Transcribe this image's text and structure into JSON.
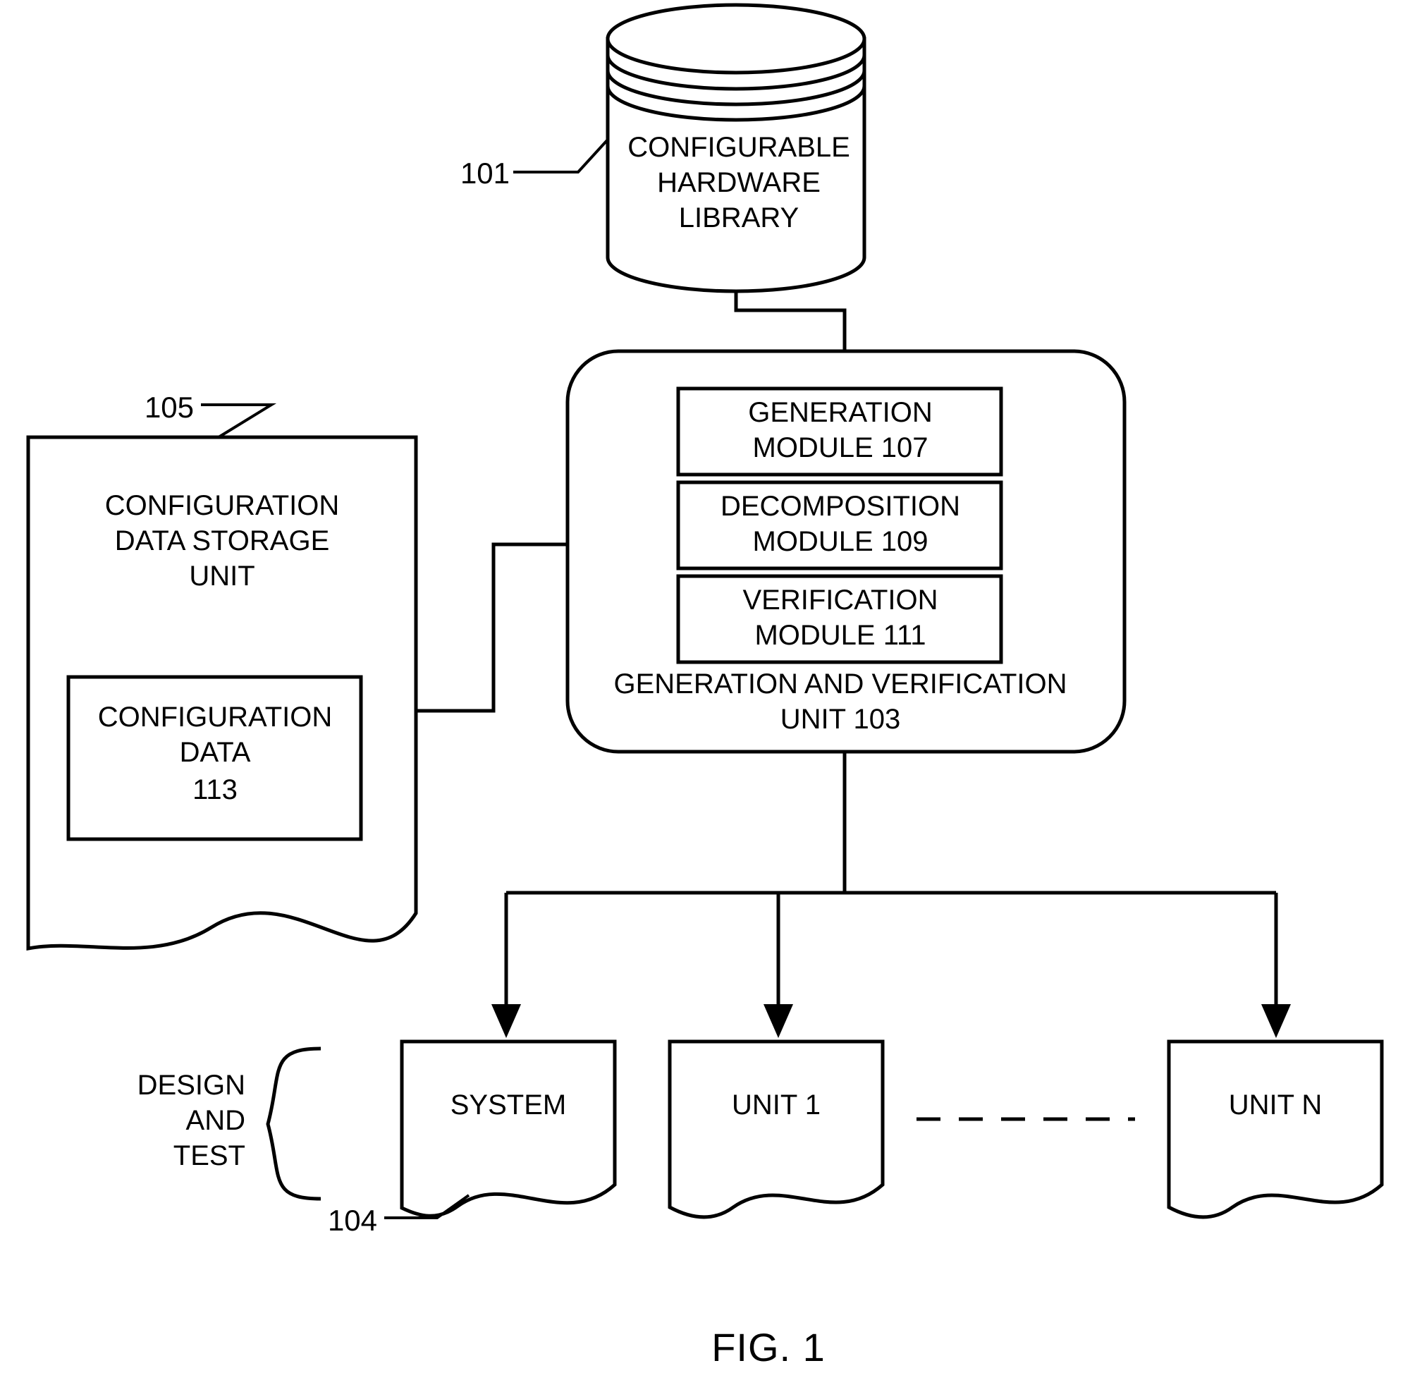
{
  "figure": {
    "caption": "FIG. 1",
    "background_color": "#ffffff",
    "line_color": "#000000"
  },
  "nodes": {
    "library": {
      "shape": "cylinder",
      "ref": "101",
      "lines": [
        "CONFIGURABLE",
        "HARDWARE",
        "LIBRARY"
      ]
    },
    "storage_unit": {
      "shape": "torn-document",
      "ref": "105",
      "lines": [
        "CONFIGURATION",
        "DATA STORAGE",
        "UNIT"
      ]
    },
    "configuration_data": {
      "shape": "rectangle",
      "lines": [
        "CONFIGURATION",
        "DATA",
        "113"
      ]
    },
    "gv_unit": {
      "shape": "rounded-rectangle",
      "ref": "103",
      "lines": [
        "GENERATION AND VERIFICATION",
        "UNIT  103"
      ]
    },
    "generation_module": {
      "shape": "rectangle",
      "ref": "107",
      "lines": [
        "GENERATION",
        "MODULE  107"
      ]
    },
    "decomposition_module": {
      "shape": "rectangle",
      "ref": "109",
      "lines": [
        "DECOMPOSITION",
        "MODULE    109"
      ]
    },
    "verification_module": {
      "shape": "rectangle",
      "ref": "111",
      "lines": [
        "VERIFICATION",
        "MODULE 111"
      ]
    },
    "system": {
      "shape": "torn-document",
      "ref": "104",
      "label": "SYSTEM"
    },
    "unit_1": {
      "shape": "torn-document",
      "label": "UNIT 1"
    },
    "unit_n": {
      "shape": "torn-document",
      "label": "UNIT N"
    }
  },
  "brace": {
    "lines": [
      "DESIGN",
      "AND",
      "TEST"
    ]
  },
  "reference_numerals": {
    "library": "101",
    "gv_unit": "103",
    "system": "104",
    "storage_unit": "105",
    "generation_module": "107",
    "decomposition_module": "109",
    "verification_module": "111",
    "configuration_data": "113"
  },
  "connectors": [
    {
      "name": "library-to-gv-unit",
      "style": "solid",
      "arrow": false
    },
    {
      "name": "storage-unit-to-gv-unit",
      "style": "solid",
      "arrow": false
    },
    {
      "name": "gv-unit-to-system",
      "style": "solid",
      "arrow": true
    },
    {
      "name": "gv-unit-to-unit-1",
      "style": "solid",
      "arrow": true
    },
    {
      "name": "gv-unit-to-unit-n",
      "style": "solid",
      "arrow": true
    },
    {
      "name": "unit-1-to-unit-n-ellipsis",
      "style": "dashed",
      "arrow": false
    }
  ]
}
